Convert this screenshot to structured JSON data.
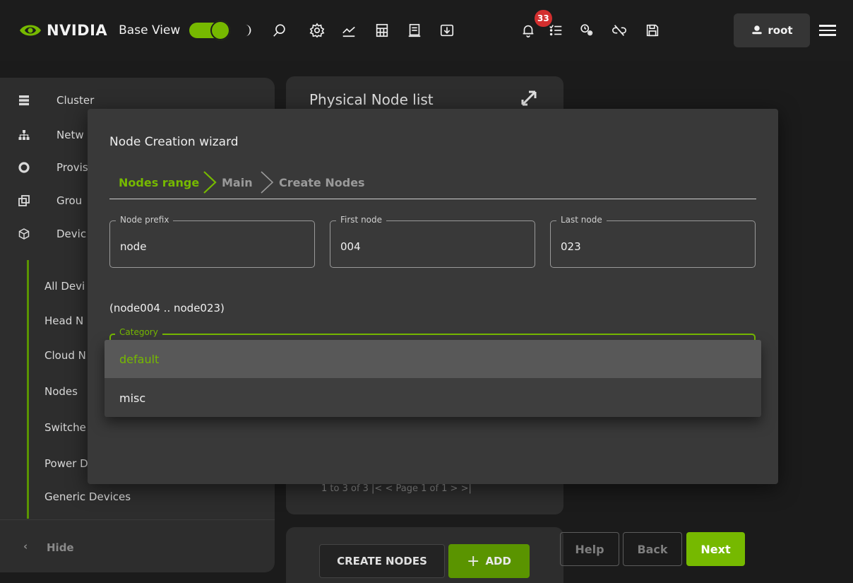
{
  "topbar": {
    "brand": "NVIDIA",
    "brand_sub": "Base View",
    "notifications_count": "33",
    "user_label": "root",
    "icons": [
      "theme-moon-icon",
      "search-icon",
      "settings-icon",
      "monitoring-icon",
      "calculator-icon",
      "notes-icon",
      "download-icon",
      "bell-icon",
      "tasks-icon",
      "cluster-settings-icon",
      "unlink-icon",
      "save-icon",
      "user-icon",
      "menu-icon"
    ]
  },
  "sidebar": {
    "items": [
      {
        "label": "Cluster",
        "icon": "server-icon"
      },
      {
        "label": "Netw",
        "icon": "network-icon"
      },
      {
        "label": "Provis",
        "icon": "disc-icon"
      },
      {
        "label": "Grou",
        "icon": "groups-icon"
      },
      {
        "label": "Devic",
        "icon": "cube-icon"
      }
    ],
    "subitems": [
      "All Devi",
      "Head N",
      "Cloud N",
      "Nodes",
      "Switche",
      "Power D",
      "Generic Devices"
    ],
    "hide_label": "Hide"
  },
  "panel": {
    "title": "Physical Node list",
    "pager": "1 to 3 of 3      |<  <  Page 1 of 1  >  >|"
  },
  "actions": {
    "create_nodes": "CREATE NODES",
    "add": "ADD"
  },
  "wizard": {
    "title": "Node Creation wizard",
    "steps": [
      "Nodes range",
      "Main",
      "Create Nodes"
    ],
    "fields": {
      "prefix_label": "Node prefix",
      "prefix_value": "node",
      "first_label": "First node",
      "first_value": "004",
      "last_label": "Last node",
      "last_value": "023"
    },
    "range_text": "(node004 .. node023)",
    "category_label": "Category",
    "category_options": [
      "default",
      "misc"
    ],
    "selected_category": "default",
    "buttons": {
      "help": "Help",
      "back": "Back",
      "next": "Next"
    }
  },
  "colors": {
    "accent": "#76b900",
    "badge": "#d32f2f",
    "modal_bg": "#393939"
  }
}
